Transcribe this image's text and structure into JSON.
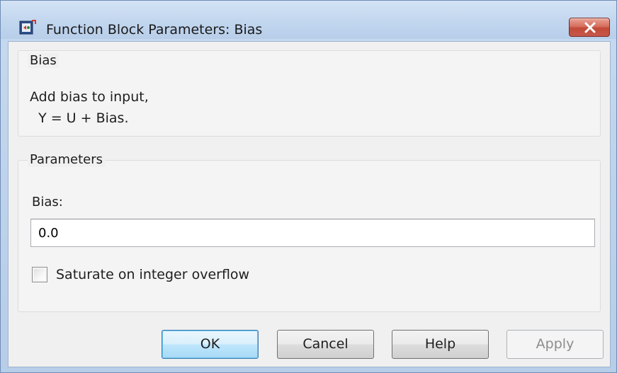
{
  "window": {
    "title": "Function Block Parameters: Bias",
    "app_icon": "simulink-block-icon",
    "close_icon": "close-icon"
  },
  "description_group": {
    "title": "Bias",
    "line1": "Add bias to input,",
    "line2": "  Y = U + Bias."
  },
  "parameters_group": {
    "title": "Parameters",
    "bias_label": "Bias:",
    "bias_value": "0.0",
    "saturate_label": "Saturate on integer overflow",
    "saturate_checked": false
  },
  "buttons": {
    "ok": "OK",
    "cancel": "Cancel",
    "help": "Help",
    "apply": "Apply"
  },
  "colors": {
    "title_bar": "#c3d7ef",
    "close_button": "#c7574a",
    "dialog_background": "#f0f0f0",
    "default_button": "#bee6fd"
  }
}
